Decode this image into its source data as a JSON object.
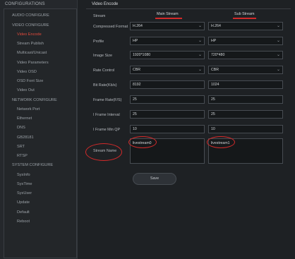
{
  "sidebar": {
    "title": "CONFIGURATIONS",
    "items": [
      {
        "label": "AUDIO CONFIGURE",
        "active": false
      },
      {
        "label": "VIDEO CONFIGURE",
        "active": false
      },
      {
        "label": "Video Encode",
        "active": true
      },
      {
        "label": "Stream Publish",
        "active": false
      },
      {
        "label": "Multicast/Unicast",
        "active": false
      },
      {
        "label": "Video Parameters",
        "active": false
      },
      {
        "label": "Video OSD",
        "active": false
      },
      {
        "label": "OSD Font Size",
        "active": false
      },
      {
        "label": "Video Out",
        "active": false
      },
      {
        "label": "NETWORK CONFIGURE",
        "active": false
      },
      {
        "label": "Network Port",
        "active": false
      },
      {
        "label": "Ethernet",
        "active": false
      },
      {
        "label": "DNS",
        "active": false
      },
      {
        "label": "GB28181",
        "active": false
      },
      {
        "label": "SRT",
        "active": false
      },
      {
        "label": "RTSP",
        "active": false
      },
      {
        "label": "SYSTEM CONFIGURE",
        "active": false
      },
      {
        "label": "SysInfo",
        "active": false
      },
      {
        "label": "SysTime",
        "active": false
      },
      {
        "label": "SysUser",
        "active": false
      },
      {
        "label": "Update",
        "active": false
      },
      {
        "label": "Default",
        "active": false
      },
      {
        "label": "Reboot",
        "active": false
      }
    ]
  },
  "main": {
    "title": "Video Encode",
    "stream_label": "Stream",
    "main_stream_label": "Main Stream",
    "sub_stream_label": "Sub Stream",
    "rows": [
      {
        "label": "Compressed Format",
        "type": "select",
        "main": "H.264",
        "sub": "H.264"
      },
      {
        "label": "Profile",
        "type": "select",
        "main": "HP",
        "sub": "HP"
      },
      {
        "label": "Image Size",
        "type": "select",
        "main": "1920*1080",
        "sub": "720*480"
      },
      {
        "label": "Rate Control",
        "type": "select",
        "main": "CBR",
        "sub": "CBR"
      },
      {
        "label": "Bit Rate(Kb/s)",
        "type": "input",
        "main": "8192",
        "sub": "1024"
      },
      {
        "label": "Frame Rate(F/S)",
        "type": "input",
        "main": "25",
        "sub": "25"
      },
      {
        "label": "I Frame Interval",
        "type": "input",
        "main": "25",
        "sub": "25"
      },
      {
        "label": "I Frame Min QP",
        "type": "input",
        "main": "10",
        "sub": "10"
      }
    ],
    "stream_name": {
      "label": "Stream Name",
      "main": "livestream0",
      "sub": "livestream1"
    },
    "save_label": "Save"
  },
  "colors": {
    "accent": "#e24a3c",
    "annotation": "#d22a2a",
    "background": "#1e2124"
  }
}
